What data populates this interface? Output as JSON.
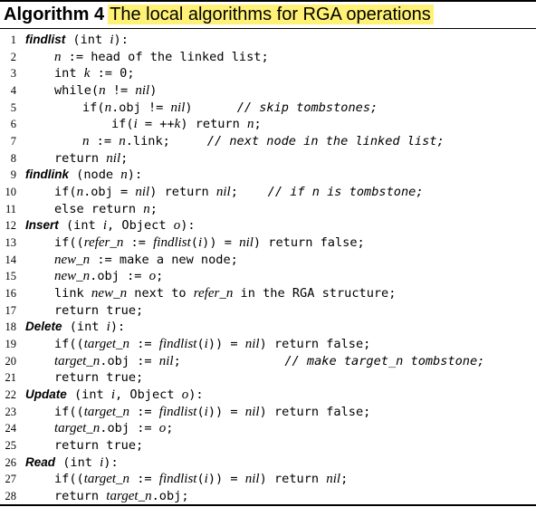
{
  "algorithm": {
    "label": "Algorithm 4",
    "title": "The local algorithms for RGA operations",
    "highlight_color": "#fff176",
    "lines": [
      {
        "num": "1",
        "indent": 0,
        "parts": [
          {
            "t": "findlist",
            "k": "kw"
          },
          {
            "t": " (int "
          },
          {
            "t": "i",
            "k": "v"
          },
          {
            "t": "):"
          }
        ]
      },
      {
        "num": "2",
        "indent": 1,
        "parts": [
          {
            "t": "n",
            "k": "v"
          },
          {
            "t": " := head of the linked list;"
          }
        ]
      },
      {
        "num": "3",
        "indent": 1,
        "parts": [
          {
            "t": "int "
          },
          {
            "t": "k",
            "k": "v"
          },
          {
            "t": " := 0;"
          }
        ]
      },
      {
        "num": "4",
        "indent": 1,
        "parts": [
          {
            "t": "while("
          },
          {
            "t": "n",
            "k": "v"
          },
          {
            "t": " != "
          },
          {
            "t": "nil",
            "k": "v"
          },
          {
            "t": ")"
          }
        ]
      },
      {
        "num": "5",
        "indent": 2,
        "parts": [
          {
            "t": "if("
          },
          {
            "t": "n",
            "k": "v"
          },
          {
            "t": ".obj != "
          },
          {
            "t": "nil",
            "k": "v"
          },
          {
            "t": ")      "
          },
          {
            "t": "// skip tombstones;",
            "k": "cm"
          }
        ]
      },
      {
        "num": "6",
        "indent": 3,
        "parts": [
          {
            "t": "if("
          },
          {
            "t": "i",
            "k": "v"
          },
          {
            "t": " = ++"
          },
          {
            "t": "k",
            "k": "v"
          },
          {
            "t": ") return "
          },
          {
            "t": "n",
            "k": "v"
          },
          {
            "t": ";"
          }
        ]
      },
      {
        "num": "7",
        "indent": 2,
        "parts": [
          {
            "t": "n",
            "k": "v"
          },
          {
            "t": " := "
          },
          {
            "t": "n",
            "k": "v"
          },
          {
            "t": ".link;     "
          },
          {
            "t": "// next node in the linked list;",
            "k": "cm"
          }
        ]
      },
      {
        "num": "8",
        "indent": 1,
        "parts": [
          {
            "t": "return "
          },
          {
            "t": "nil",
            "k": "v"
          },
          {
            "t": ";"
          }
        ]
      },
      {
        "num": "9",
        "indent": 0,
        "parts": [
          {
            "t": "findlink",
            "k": "kw"
          },
          {
            "t": " (node "
          },
          {
            "t": "n",
            "k": "v"
          },
          {
            "t": "):"
          }
        ]
      },
      {
        "num": "10",
        "indent": 1,
        "parts": [
          {
            "t": "if("
          },
          {
            "t": "n",
            "k": "v"
          },
          {
            "t": ".obj = "
          },
          {
            "t": "nil",
            "k": "v"
          },
          {
            "t": ") return "
          },
          {
            "t": "nil",
            "k": "v"
          },
          {
            "t": ";    "
          },
          {
            "t": "// if n is tombstone;",
            "k": "cm"
          }
        ]
      },
      {
        "num": "11",
        "indent": 1,
        "parts": [
          {
            "t": "else return "
          },
          {
            "t": "n",
            "k": "v"
          },
          {
            "t": ";"
          }
        ]
      },
      {
        "num": "12",
        "indent": 0,
        "parts": [
          {
            "t": "Insert",
            "k": "kw"
          },
          {
            "t": " (int "
          },
          {
            "t": "i",
            "k": "v"
          },
          {
            "t": ", Object "
          },
          {
            "t": "o",
            "k": "v"
          },
          {
            "t": "):"
          }
        ]
      },
      {
        "num": "13",
        "indent": 1,
        "parts": [
          {
            "t": "if(("
          },
          {
            "t": "refer_n",
            "k": "v"
          },
          {
            "t": " := "
          },
          {
            "t": "findlist",
            "k": "v"
          },
          {
            "t": "("
          },
          {
            "t": "i",
            "k": "v"
          },
          {
            "t": ")) = "
          },
          {
            "t": "nil",
            "k": "v"
          },
          {
            "t": ") return false;"
          }
        ]
      },
      {
        "num": "14",
        "indent": 1,
        "parts": [
          {
            "t": "new_n",
            "k": "v"
          },
          {
            "t": " := make a new node;"
          }
        ]
      },
      {
        "num": "15",
        "indent": 1,
        "parts": [
          {
            "t": "new_n",
            "k": "v"
          },
          {
            "t": ".obj := "
          },
          {
            "t": "o",
            "k": "v"
          },
          {
            "t": ";"
          }
        ]
      },
      {
        "num": "16",
        "indent": 1,
        "parts": [
          {
            "t": "link "
          },
          {
            "t": "new_n",
            "k": "v"
          },
          {
            "t": " next to "
          },
          {
            "t": "refer_n",
            "k": "v"
          },
          {
            "t": " in the RGA structure;"
          }
        ]
      },
      {
        "num": "17",
        "indent": 1,
        "parts": [
          {
            "t": "return true;"
          }
        ]
      },
      {
        "num": "18",
        "indent": 0,
        "parts": [
          {
            "t": "Delete",
            "k": "kw"
          },
          {
            "t": " (int "
          },
          {
            "t": "i",
            "k": "v"
          },
          {
            "t": "):"
          }
        ]
      },
      {
        "num": "19",
        "indent": 1,
        "parts": [
          {
            "t": "if(("
          },
          {
            "t": "target_n",
            "k": "v"
          },
          {
            "t": " := "
          },
          {
            "t": "findlist",
            "k": "v"
          },
          {
            "t": "("
          },
          {
            "t": "i",
            "k": "v"
          },
          {
            "t": ")) = "
          },
          {
            "t": "nil",
            "k": "v"
          },
          {
            "t": ") return false;"
          }
        ]
      },
      {
        "num": "20",
        "indent": 1,
        "parts": [
          {
            "t": "target_n",
            "k": "v"
          },
          {
            "t": ".obj := "
          },
          {
            "t": "nil",
            "k": "v"
          },
          {
            "t": ";              "
          },
          {
            "t": "// make target_n tombstone;",
            "k": "cm"
          }
        ]
      },
      {
        "num": "21",
        "indent": 1,
        "parts": [
          {
            "t": "return true;"
          }
        ]
      },
      {
        "num": "22",
        "indent": 0,
        "parts": [
          {
            "t": "Update",
            "k": "kw"
          },
          {
            "t": " (int "
          },
          {
            "t": "i",
            "k": "v"
          },
          {
            "t": ", Object "
          },
          {
            "t": "o",
            "k": "v"
          },
          {
            "t": "):"
          }
        ]
      },
      {
        "num": "23",
        "indent": 1,
        "parts": [
          {
            "t": "if(("
          },
          {
            "t": "target_n",
            "k": "v"
          },
          {
            "t": " := "
          },
          {
            "t": "findlist",
            "k": "v"
          },
          {
            "t": "("
          },
          {
            "t": "i",
            "k": "v"
          },
          {
            "t": ")) = "
          },
          {
            "t": "nil",
            "k": "v"
          },
          {
            "t": ") return false;"
          }
        ]
      },
      {
        "num": "24",
        "indent": 1,
        "parts": [
          {
            "t": "target_n",
            "k": "v"
          },
          {
            "t": ".obj := "
          },
          {
            "t": "o",
            "k": "v"
          },
          {
            "t": ";"
          }
        ]
      },
      {
        "num": "25",
        "indent": 1,
        "parts": [
          {
            "t": "return true;"
          }
        ]
      },
      {
        "num": "26",
        "indent": 0,
        "parts": [
          {
            "t": "Read",
            "k": "kw"
          },
          {
            "t": " (int "
          },
          {
            "t": "i",
            "k": "v"
          },
          {
            "t": "):"
          }
        ]
      },
      {
        "num": "27",
        "indent": 1,
        "parts": [
          {
            "t": "if(("
          },
          {
            "t": "target_n",
            "k": "v"
          },
          {
            "t": " := "
          },
          {
            "t": "findlist",
            "k": "v"
          },
          {
            "t": "("
          },
          {
            "t": "i",
            "k": "v"
          },
          {
            "t": ")) = "
          },
          {
            "t": "nil",
            "k": "v"
          },
          {
            "t": ") return "
          },
          {
            "t": "nil",
            "k": "v"
          },
          {
            "t": ";"
          }
        ]
      },
      {
        "num": "28",
        "indent": 1,
        "parts": [
          {
            "t": "return "
          },
          {
            "t": "target_n",
            "k": "v"
          },
          {
            "t": ".obj;"
          }
        ]
      }
    ]
  }
}
